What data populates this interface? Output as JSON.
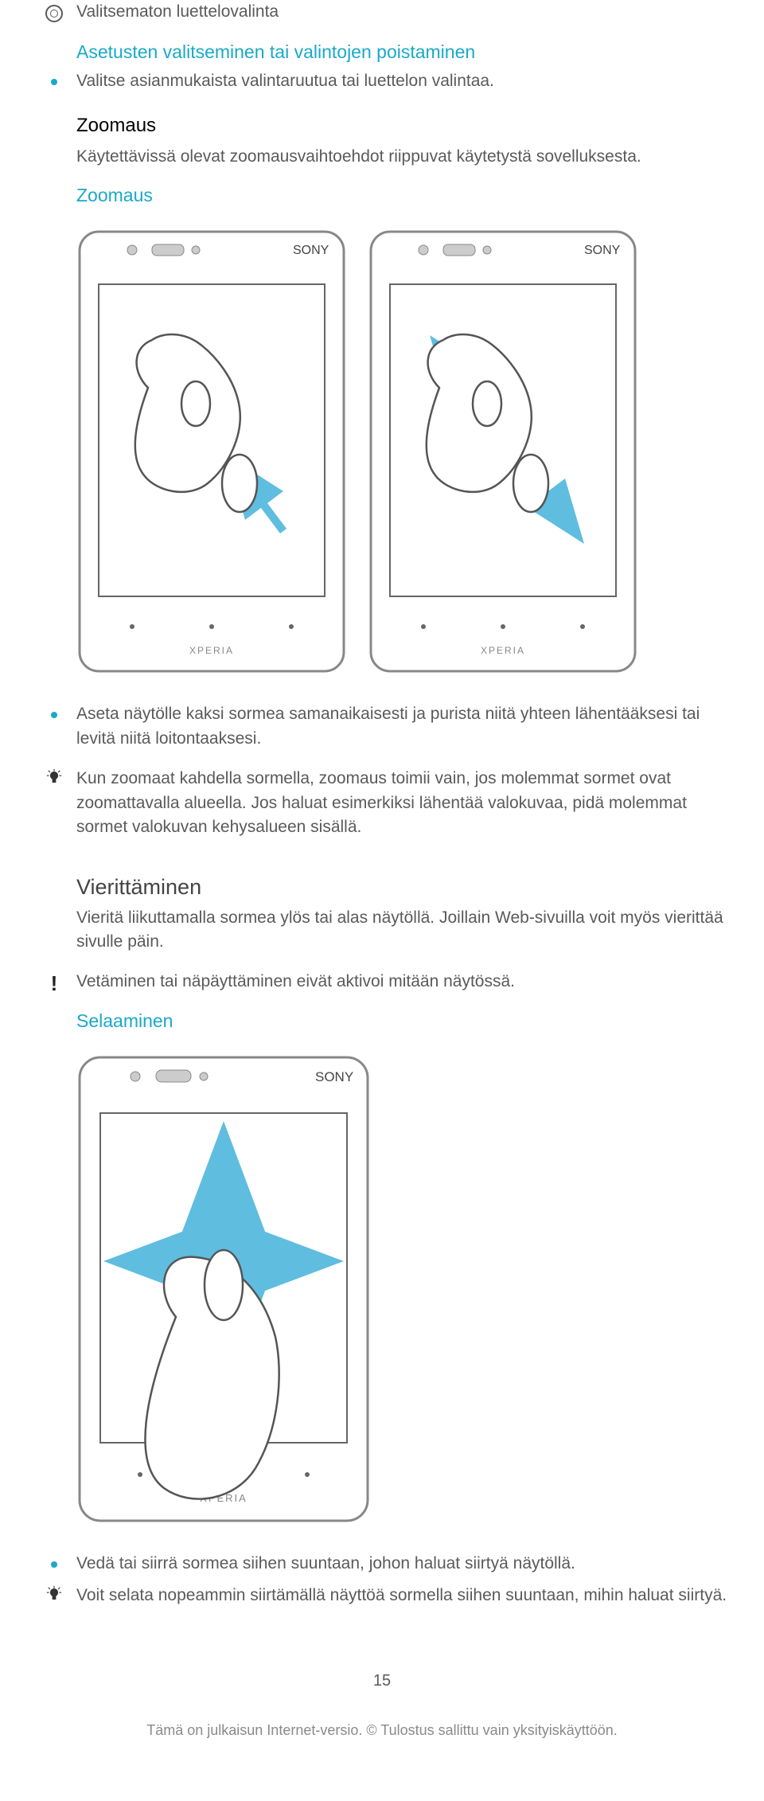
{
  "labels": {
    "unselected_radio": "Valitsematon luettelovalinta"
  },
  "section1": {
    "heading": "Asetusten valitseminen tai valintojen poistaminen",
    "bullet": "Valitse asianmukaista valintaruutua tai luettelon valintaa."
  },
  "section2": {
    "title": "Zoomaus",
    "intro": "Käytettävissä olevat zoomausvaihtoehdot riippuvat käytetystä sovelluksesta.",
    "subheading": "Zoomaus",
    "bullet": "Aseta näytölle kaksi sormea samanaikaisesti ja purista niitä yhteen lähentääksesi tai levitä niitä loitontaaksesi.",
    "tip": "Kun zoomaat kahdella sormella, zoomaus toimii vain, jos molemmat sormet ovat zoomattavalla alueella. Jos haluat esimerkiksi lähentää valokuvaa, pidä molemmat sormet valokuvan kehysalueen sisällä."
  },
  "section3": {
    "title": "Vierittäminen",
    "intro": "Vieritä liikuttamalla sormea ylös tai alas näytöllä. Joillain Web-sivuilla voit myös vierittää sivulle päin.",
    "warn": "Vetäminen tai näpäyttäminen eivät aktivoi mitään näytössä.",
    "subheading": "Selaaminen",
    "bullet": "Vedä tai siirrä sormea siihen suuntaan, johon haluat siirtyä näytöllä.",
    "tip": "Voit selata nopeammin siirtämällä näyttöä sormella siihen suuntaan, mihin haluat siirtyä."
  },
  "phone_brand": "SONY",
  "phone_series": "XPERIA",
  "pagenum": "15",
  "footer": "Tämä on julkaisun Internet-versio. © Tulostus sallittu vain yksityiskäyttöön."
}
